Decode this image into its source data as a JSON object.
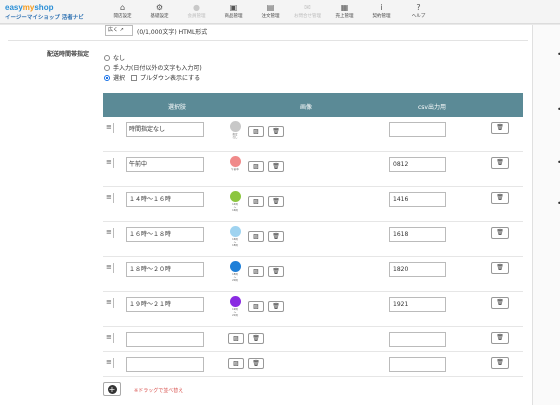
{
  "brand": {
    "logo_a": "easy",
    "logo_b": "my",
    "logo_c": "shop",
    "subtitle": "イージーマイショップ 活者ナビ"
  },
  "nav": [
    {
      "label": "開店設定",
      "icon": "home-icon",
      "glyph": "⌂",
      "disabled": false
    },
    {
      "label": "基礎設定",
      "icon": "gear-icon",
      "glyph": "⚙",
      "disabled": false
    },
    {
      "label": "会員管理",
      "icon": "person-icon",
      "glyph": "●",
      "disabled": true
    },
    {
      "label": "商品管理",
      "icon": "gift-icon",
      "glyph": "▣",
      "disabled": false
    },
    {
      "label": "注文管理",
      "icon": "document-icon",
      "glyph": "▤",
      "disabled": false
    },
    {
      "label": "お問合せ管理",
      "icon": "mail-icon",
      "glyph": "✉",
      "disabled": true
    },
    {
      "label": "売上管理",
      "icon": "chart-icon",
      "glyph": "▦",
      "disabled": false
    },
    {
      "label": "契約管理",
      "icon": "info-icon",
      "glyph": "i",
      "disabled": false
    },
    {
      "label": "ヘルプ",
      "icon": "help-icon",
      "glyph": "?",
      "disabled": false
    }
  ],
  "upper": {
    "expand_label": "広く ↗",
    "counter": "(0/1,000文字) HTML形式"
  },
  "section": {
    "label": "配送時間帯指定",
    "options": [
      "なし",
      "手入力(日付以外の文字も入力可)",
      "選択"
    ],
    "selected": "選択",
    "dropdown_checkbox_label": "プルダウン表示にする"
  },
  "table": {
    "headers": {
      "name": "選択肢",
      "image": "画像",
      "csv": "csv出力用"
    },
    "rows": [
      {
        "name": "時間指定なし",
        "csv": "",
        "has_image": true,
        "color": "#c8c8c8",
        "caption": "指定\nなし"
      },
      {
        "name": "午前中",
        "csv": "0812",
        "has_image": true,
        "color": "#f08a8a",
        "caption": "午前中"
      },
      {
        "name": "１４時～１６時",
        "csv": "1416",
        "has_image": true,
        "color": "#8cc63f",
        "caption": "14時\n～\n16時"
      },
      {
        "name": "１６時～１８時",
        "csv": "1618",
        "has_image": true,
        "color": "#9fd3f0",
        "caption": "16時\n～\n18時"
      },
      {
        "name": "１８時～２０時",
        "csv": "1820",
        "has_image": true,
        "color": "#1e7fd8",
        "caption": "18時\n～\n20時"
      },
      {
        "name": "１９時～２１時",
        "csv": "1921",
        "has_image": true,
        "color": "#8a2be2",
        "caption": "19時\n～\n21時"
      },
      {
        "name": "",
        "csv": "",
        "has_image": false,
        "color": "",
        "caption": ""
      },
      {
        "name": "",
        "csv": "",
        "has_image": false,
        "color": "",
        "caption": ""
      }
    ]
  },
  "footer": {
    "add_label": "+",
    "hint": "※ドラッグで並べ替え"
  },
  "icons": {
    "image": "image-icon",
    "trash": "trash-icon",
    "drag": "drag-handle-icon",
    "add": "plus-icon"
  }
}
